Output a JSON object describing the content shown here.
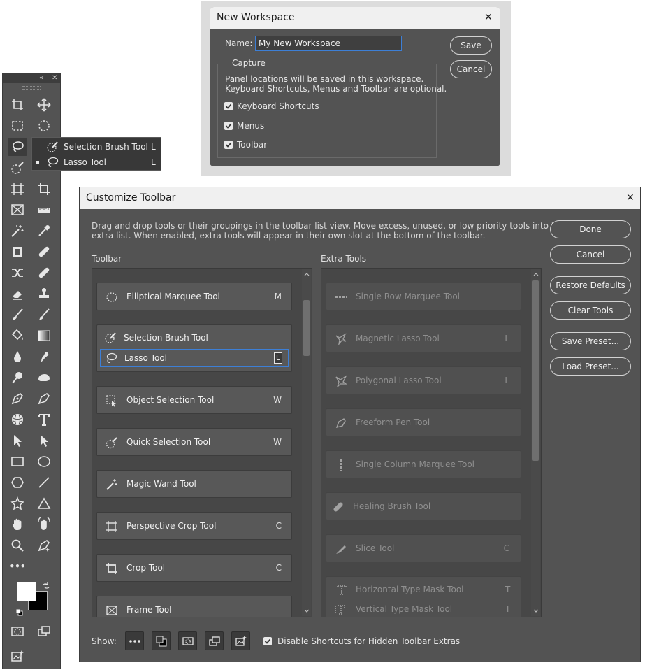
{
  "toolbar": {
    "collapse_glyph": "«",
    "close_glyph": "✕",
    "more_glyph": "•••",
    "tools_left": [
      "artboard-icon",
      "rect-marquee-icon",
      "lasso-icon",
      "quick-selection-icon",
      "perspective-crop-icon",
      "frame-icon",
      "magic-wand-icon",
      "object-selection-icon",
      "content-aware-move-icon",
      "eraser-icon",
      "brush-mixer-icon",
      "paint-bucket-icon",
      "blur-icon",
      "dodge-icon",
      "pen-icon",
      "3d-icon",
      "path-selection-icon",
      "rectangle-icon",
      "polygon-icon",
      "custom-shape-icon",
      "hand-icon",
      "zoom-icon"
    ],
    "tools_right": [
      "move-icon",
      "ellipse-marquee-icon",
      "",
      "",
      "crop-icon",
      "ruler-icon",
      "eyedropper-icon",
      "healing-icon",
      "patch-icon",
      "stamp-icon",
      "brush-icon",
      "gradient-icon",
      "smudge-icon",
      "sponge-icon",
      "freeform-pen-icon",
      "type-icon",
      "direct-selection-icon",
      "ellipse-icon",
      "line-icon",
      "triangle-icon",
      "rotate-view-icon",
      "generative-fill-icon"
    ]
  },
  "flyout": {
    "items": [
      {
        "label": "Selection Brush Tool",
        "key": "L"
      },
      {
        "label": "Lasso Tool",
        "key": "L"
      }
    ]
  },
  "new_workspace": {
    "title": "New Workspace",
    "close": "✕",
    "name_label": "Name:",
    "name_value": "My New Workspace",
    "save_label": "Save",
    "cancel_label": "Cancel",
    "capture_legend": "Capture",
    "capture_line1": "Panel locations will be saved in this workspace.",
    "capture_line2": "Keyboard Shortcuts, Menus and Toolbar are optional.",
    "options": [
      {
        "label": "Keyboard Shortcuts",
        "checked": true
      },
      {
        "label": "Menus",
        "checked": true
      },
      {
        "label": "Toolbar",
        "checked": true
      }
    ]
  },
  "customize": {
    "title": "Customize Toolbar",
    "close": "✕",
    "description_line1": "Drag and drop tools or their groupings in the toolbar list view. Move excess, unused, or low priority tools into the",
    "description_line2": "extra list. When enabled, extra tools will appear in their own slot at the bottom of the toolbar.",
    "toolbar_heading": "Toolbar",
    "extra_heading": "Extra Tools",
    "toolbar_items": [
      {
        "label": "Elliptical Marquee Tool",
        "key": "M"
      },
      {
        "label": "Object Selection Tool",
        "key": "W"
      },
      {
        "label": "Quick Selection Tool",
        "key": "W"
      },
      {
        "label": "Magic Wand Tool",
        "key": ""
      },
      {
        "label": "Perspective Crop Tool",
        "key": "C"
      },
      {
        "label": "Crop Tool",
        "key": "C"
      },
      {
        "label": "Frame Tool",
        "key": ""
      }
    ],
    "lasso_group": [
      {
        "label": "Selection Brush Tool",
        "key": ""
      },
      {
        "label": "Lasso Tool",
        "key": "L"
      }
    ],
    "extra_items": [
      {
        "label": "Single Row Marquee Tool",
        "key": ""
      },
      {
        "label": "Magnetic Lasso Tool",
        "key": "L"
      },
      {
        "label": "Polygonal Lasso Tool",
        "key": "L"
      },
      {
        "label": "Freeform Pen Tool",
        "key": ""
      },
      {
        "label": "Single Column Marquee Tool",
        "key": ""
      },
      {
        "label": "Healing Brush Tool",
        "key": ""
      },
      {
        "label": "Slice Tool",
        "key": "C"
      }
    ],
    "type_mask_group": [
      {
        "label": "Horizontal Type Mask Tool",
        "key": "T"
      },
      {
        "label": "Vertical Type Mask Tool",
        "key": "T"
      }
    ],
    "buttons": {
      "done": "Done",
      "cancel": "Cancel",
      "restore": "Restore Defaults",
      "clear": "Clear Tools",
      "save_preset": "Save Preset...",
      "load_preset": "Load Preset..."
    },
    "show_label": "Show:",
    "disable_label": "Disable Shortcuts for Hidden Toolbar Extras",
    "disable_checked": true
  }
}
